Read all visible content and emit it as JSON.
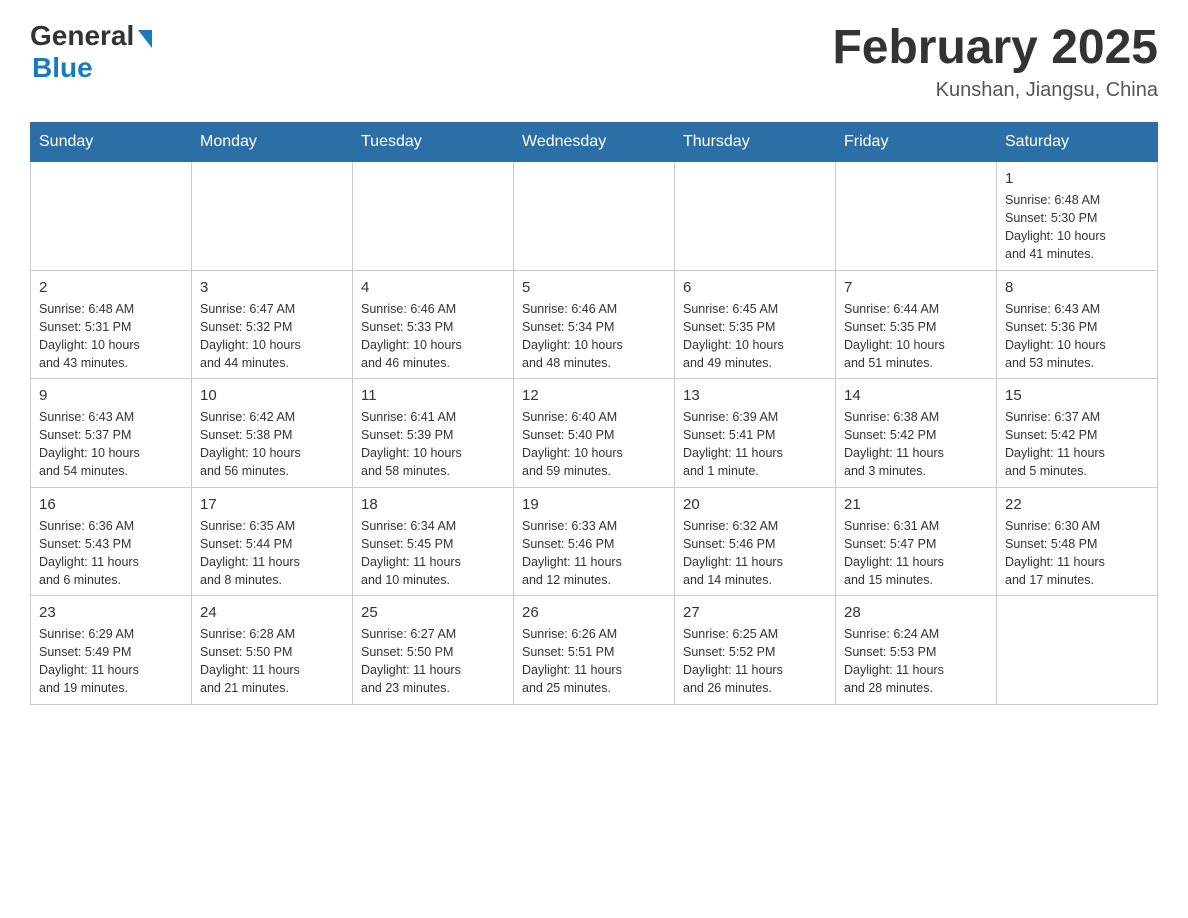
{
  "logo": {
    "general": "General",
    "blue": "Blue"
  },
  "title": "February 2025",
  "location": "Kunshan, Jiangsu, China",
  "weekdays": [
    "Sunday",
    "Monday",
    "Tuesday",
    "Wednesday",
    "Thursday",
    "Friday",
    "Saturday"
  ],
  "weeks": [
    [
      {
        "day": "",
        "info": ""
      },
      {
        "day": "",
        "info": ""
      },
      {
        "day": "",
        "info": ""
      },
      {
        "day": "",
        "info": ""
      },
      {
        "day": "",
        "info": ""
      },
      {
        "day": "",
        "info": ""
      },
      {
        "day": "1",
        "info": "Sunrise: 6:48 AM\nSunset: 5:30 PM\nDaylight: 10 hours\nand 41 minutes."
      }
    ],
    [
      {
        "day": "2",
        "info": "Sunrise: 6:48 AM\nSunset: 5:31 PM\nDaylight: 10 hours\nand 43 minutes."
      },
      {
        "day": "3",
        "info": "Sunrise: 6:47 AM\nSunset: 5:32 PM\nDaylight: 10 hours\nand 44 minutes."
      },
      {
        "day": "4",
        "info": "Sunrise: 6:46 AM\nSunset: 5:33 PM\nDaylight: 10 hours\nand 46 minutes."
      },
      {
        "day": "5",
        "info": "Sunrise: 6:46 AM\nSunset: 5:34 PM\nDaylight: 10 hours\nand 48 minutes."
      },
      {
        "day": "6",
        "info": "Sunrise: 6:45 AM\nSunset: 5:35 PM\nDaylight: 10 hours\nand 49 minutes."
      },
      {
        "day": "7",
        "info": "Sunrise: 6:44 AM\nSunset: 5:35 PM\nDaylight: 10 hours\nand 51 minutes."
      },
      {
        "day": "8",
        "info": "Sunrise: 6:43 AM\nSunset: 5:36 PM\nDaylight: 10 hours\nand 53 minutes."
      }
    ],
    [
      {
        "day": "9",
        "info": "Sunrise: 6:43 AM\nSunset: 5:37 PM\nDaylight: 10 hours\nand 54 minutes."
      },
      {
        "day": "10",
        "info": "Sunrise: 6:42 AM\nSunset: 5:38 PM\nDaylight: 10 hours\nand 56 minutes."
      },
      {
        "day": "11",
        "info": "Sunrise: 6:41 AM\nSunset: 5:39 PM\nDaylight: 10 hours\nand 58 minutes."
      },
      {
        "day": "12",
        "info": "Sunrise: 6:40 AM\nSunset: 5:40 PM\nDaylight: 10 hours\nand 59 minutes."
      },
      {
        "day": "13",
        "info": "Sunrise: 6:39 AM\nSunset: 5:41 PM\nDaylight: 11 hours\nand 1 minute."
      },
      {
        "day": "14",
        "info": "Sunrise: 6:38 AM\nSunset: 5:42 PM\nDaylight: 11 hours\nand 3 minutes."
      },
      {
        "day": "15",
        "info": "Sunrise: 6:37 AM\nSunset: 5:42 PM\nDaylight: 11 hours\nand 5 minutes."
      }
    ],
    [
      {
        "day": "16",
        "info": "Sunrise: 6:36 AM\nSunset: 5:43 PM\nDaylight: 11 hours\nand 6 minutes."
      },
      {
        "day": "17",
        "info": "Sunrise: 6:35 AM\nSunset: 5:44 PM\nDaylight: 11 hours\nand 8 minutes."
      },
      {
        "day": "18",
        "info": "Sunrise: 6:34 AM\nSunset: 5:45 PM\nDaylight: 11 hours\nand 10 minutes."
      },
      {
        "day": "19",
        "info": "Sunrise: 6:33 AM\nSunset: 5:46 PM\nDaylight: 11 hours\nand 12 minutes."
      },
      {
        "day": "20",
        "info": "Sunrise: 6:32 AM\nSunset: 5:46 PM\nDaylight: 11 hours\nand 14 minutes."
      },
      {
        "day": "21",
        "info": "Sunrise: 6:31 AM\nSunset: 5:47 PM\nDaylight: 11 hours\nand 15 minutes."
      },
      {
        "day": "22",
        "info": "Sunrise: 6:30 AM\nSunset: 5:48 PM\nDaylight: 11 hours\nand 17 minutes."
      }
    ],
    [
      {
        "day": "23",
        "info": "Sunrise: 6:29 AM\nSunset: 5:49 PM\nDaylight: 11 hours\nand 19 minutes."
      },
      {
        "day": "24",
        "info": "Sunrise: 6:28 AM\nSunset: 5:50 PM\nDaylight: 11 hours\nand 21 minutes."
      },
      {
        "day": "25",
        "info": "Sunrise: 6:27 AM\nSunset: 5:50 PM\nDaylight: 11 hours\nand 23 minutes."
      },
      {
        "day": "26",
        "info": "Sunrise: 6:26 AM\nSunset: 5:51 PM\nDaylight: 11 hours\nand 25 minutes."
      },
      {
        "day": "27",
        "info": "Sunrise: 6:25 AM\nSunset: 5:52 PM\nDaylight: 11 hours\nand 26 minutes."
      },
      {
        "day": "28",
        "info": "Sunrise: 6:24 AM\nSunset: 5:53 PM\nDaylight: 11 hours\nand 28 minutes."
      },
      {
        "day": "",
        "info": ""
      }
    ]
  ]
}
